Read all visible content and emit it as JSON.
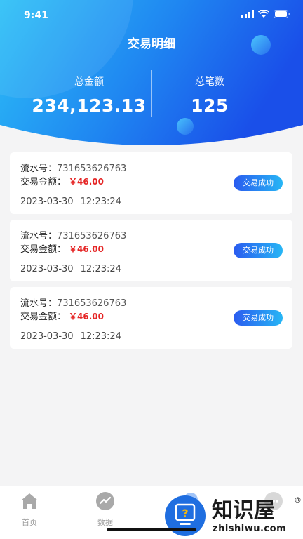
{
  "status_bar": {
    "time": "9:41"
  },
  "header": {
    "title": "交易明细",
    "total_amount_label": "总金额",
    "total_amount_value": "234,123.13",
    "total_count_label": "总笔数",
    "total_count_value": "125"
  },
  "transactions": [
    {
      "serial_label": "流水号：",
      "serial": "731653626763",
      "amount_label": "交易金额：",
      "amount": "￥46.00",
      "date": "2023-03-30",
      "time": "12:23:24",
      "status": "交易成功"
    },
    {
      "serial_label": "流水号：",
      "serial": "731653626763",
      "amount_label": "交易金额：",
      "amount": "￥46.00",
      "date": "2023-03-30",
      "time": "12:23:24",
      "status": "交易成功"
    },
    {
      "serial_label": "流水号：",
      "serial": "731653626763",
      "amount_label": "交易金额：",
      "amount": "￥46.00",
      "date": "2023-03-30",
      "time": "12:23:24",
      "status": "交易成功"
    }
  ],
  "tabbar": [
    {
      "label": "首页",
      "icon": "home-icon"
    },
    {
      "label": "数据",
      "icon": "chart-icon"
    },
    {
      "label": "",
      "icon": "tab-3-icon"
    },
    {
      "label": "",
      "icon": "message-icon"
    }
  ],
  "watermark": {
    "brand": "知识屋",
    "domain": "zhishiwu.com",
    "reg": "®"
  },
  "colors": {
    "header_start": "#27b8f6",
    "header_end": "#1a52ea",
    "amount_red": "#e52525",
    "badge_start": "#2a5bef",
    "badge_end": "#27b6f5"
  }
}
